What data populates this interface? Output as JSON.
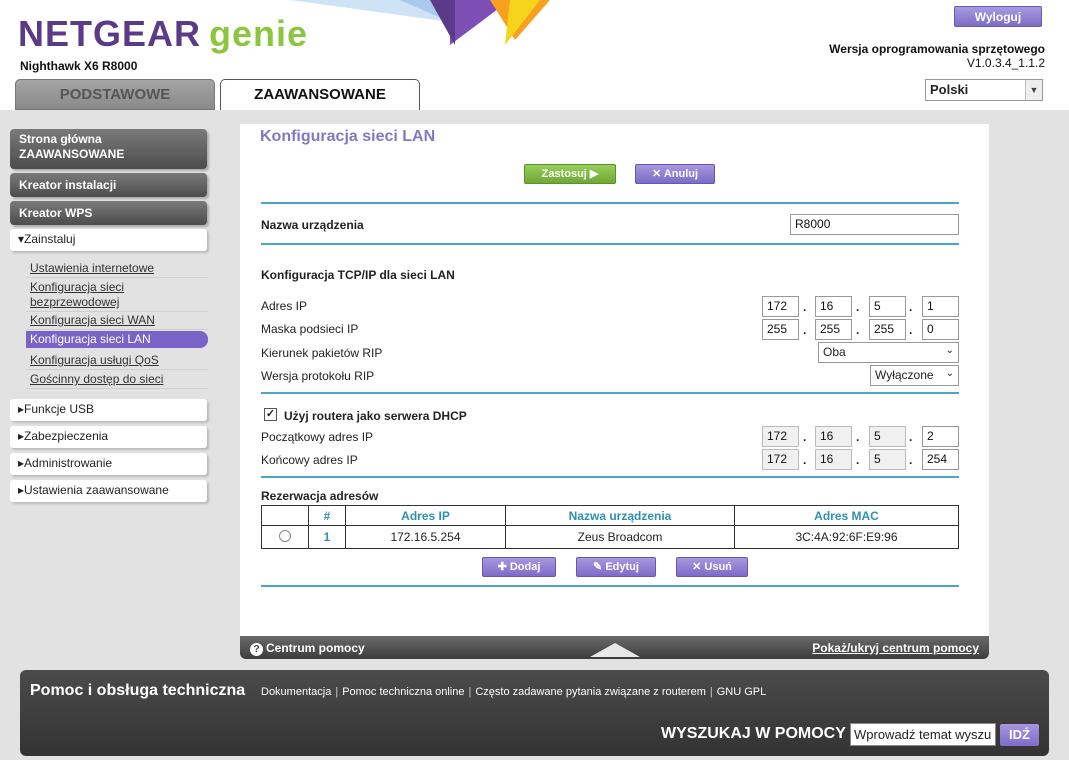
{
  "brand": {
    "name": "NETGEAR",
    "product": "genie",
    "model": "Nighthawk X6 R8000"
  },
  "header": {
    "logout": "Wyloguj",
    "firmware_label": "Wersja oprogramowania sprzętowego",
    "firmware_version": "V1.0.3.4_1.1.2",
    "language": "Polski",
    "tabs": {
      "basic": "PODSTAWOWE",
      "advanced": "ZAAWANSOWANE"
    }
  },
  "sidebar": {
    "home": "Strona główna ZAAWANSOWANE",
    "wizard": "Kreator instalacji",
    "wps": "Kreator WPS",
    "install": "Zainstaluj",
    "install_items": [
      "Ustawienia internetowe",
      "Konfiguracja sieci bezprzewodowej",
      "Konfiguracja sieci WAN",
      "Konfiguracja sieci LAN",
      "Konfiguracja usługi QoS",
      "Gościnny dostęp do sieci"
    ],
    "usb": "Funkcje USB",
    "security": "Zabezpieczenia",
    "admin": "Administrowanie",
    "advanced": "Ustawienia zaawansowane"
  },
  "page": {
    "title": "Konfiguracja sieci LAN",
    "apply": "Zastosuj",
    "cancel": "Anuluj",
    "device_name_label": "Nazwa urządzenia",
    "device_name": "R8000",
    "tcpip_header": "Konfiguracja TCP/IP dla sieci LAN",
    "ip_label": "Adres IP",
    "ip": [
      "172",
      "16",
      "5",
      "1"
    ],
    "mask_label": "Maska podsieci IP",
    "mask": [
      "255",
      "255",
      "255",
      "0"
    ],
    "rip_dir_label": "Kierunek pakietów RIP",
    "rip_dir": "Oba",
    "rip_ver_label": "Wersja protokołu RIP",
    "rip_ver": "Wyłączone",
    "dhcp_label": "Użyj routera jako serwera DHCP",
    "dhcp_checked": true,
    "start_label": "Początkowy adres IP",
    "start": [
      "172",
      "16",
      "5",
      "2"
    ],
    "end_label": "Końcowy adres IP",
    "end": [
      "172",
      "16",
      "5",
      "254"
    ],
    "reservation_label": "Rezerwacja adresów",
    "table_headers": [
      "#",
      "Adres IP",
      "Nazwa urządzenia",
      "Adres MAC"
    ],
    "table_rows": [
      {
        "num": "1",
        "ip": "172.16.5.254",
        "name": "Zeus Broadcom",
        "mac": "3C:4A:92:6F:E9:96"
      }
    ],
    "add": "Dodaj",
    "edit": "Edytuj",
    "delete": "Usuń"
  },
  "helpbar": {
    "left": "Centrum pomocy",
    "right": "Pokaż/ukryj centrum pomocy"
  },
  "footer": {
    "title": "Pomoc i obsługa techniczna",
    "links": [
      "Dokumentacja",
      "Pomoc techniczna online",
      "Często zadawane pytania związane z routerem",
      "GNU GPL"
    ],
    "search_label": "WYSZUKAJ W POMOCY",
    "search_placeholder": "Wprowadź temat wyszu",
    "go": "IDŹ"
  },
  "colors": {
    "accent": "#7a63c7",
    "green": "#8cc63f",
    "rule": "#4aa7c8",
    "brand_purple": "#5b3a87"
  }
}
